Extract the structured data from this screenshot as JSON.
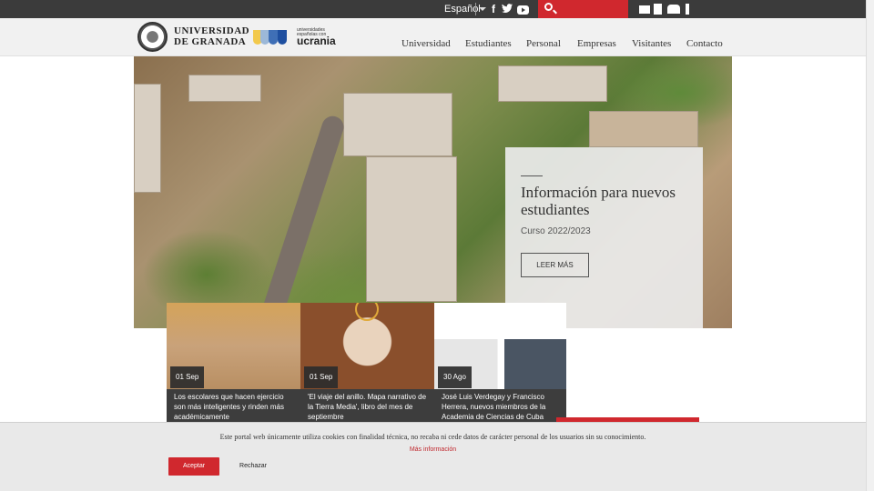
{
  "topbar": {
    "language": "Español",
    "social": [
      "facebook-icon",
      "twitter-icon",
      "youtube-icon"
    ],
    "tools": [
      "mail-icon",
      "directory-icon",
      "users-icon",
      "info-icon"
    ]
  },
  "header": {
    "university_line1": "UNIVERSIDAD",
    "university_line2": "DE GRANADA",
    "uc_small": "universidades españolas con",
    "uc_big": "ucrania",
    "nav": [
      "Universidad",
      "Estudiantes",
      "Personal",
      "Empresas",
      "Visitantes",
      "Contacto"
    ]
  },
  "hero": {
    "title": "Información para nuevos estudiantes",
    "subtitle": "Curso 2022/2023",
    "button": "LEER MÁS"
  },
  "news": [
    {
      "date": "01 Sep",
      "title": "Los escolares que hacen ejercicio son más inteligentes y rinden más académicamente"
    },
    {
      "date": "01 Sep",
      "title": "'El viaje del anillo. Mapa narrativo de la Tierra Media', libro del mes de septiembre"
    },
    {
      "date": "30 Ago",
      "title": "José Luis Verdegay y Francisco Herrera, nuevos miembros de la Academia de Ciencias de Cuba"
    }
  ],
  "cookie": {
    "message": "Este portal web únicamente utiliza cookies con finalidad técnica, no recaba ni cede datos de carácter personal de los usuarios sin su conocimiento.",
    "more": "Más información",
    "accept": "Aceptar",
    "reject": "Rechazar"
  },
  "colors": {
    "accent": "#d0282e",
    "topbar": "#3b3b3b",
    "header": "#f1f1f1"
  }
}
